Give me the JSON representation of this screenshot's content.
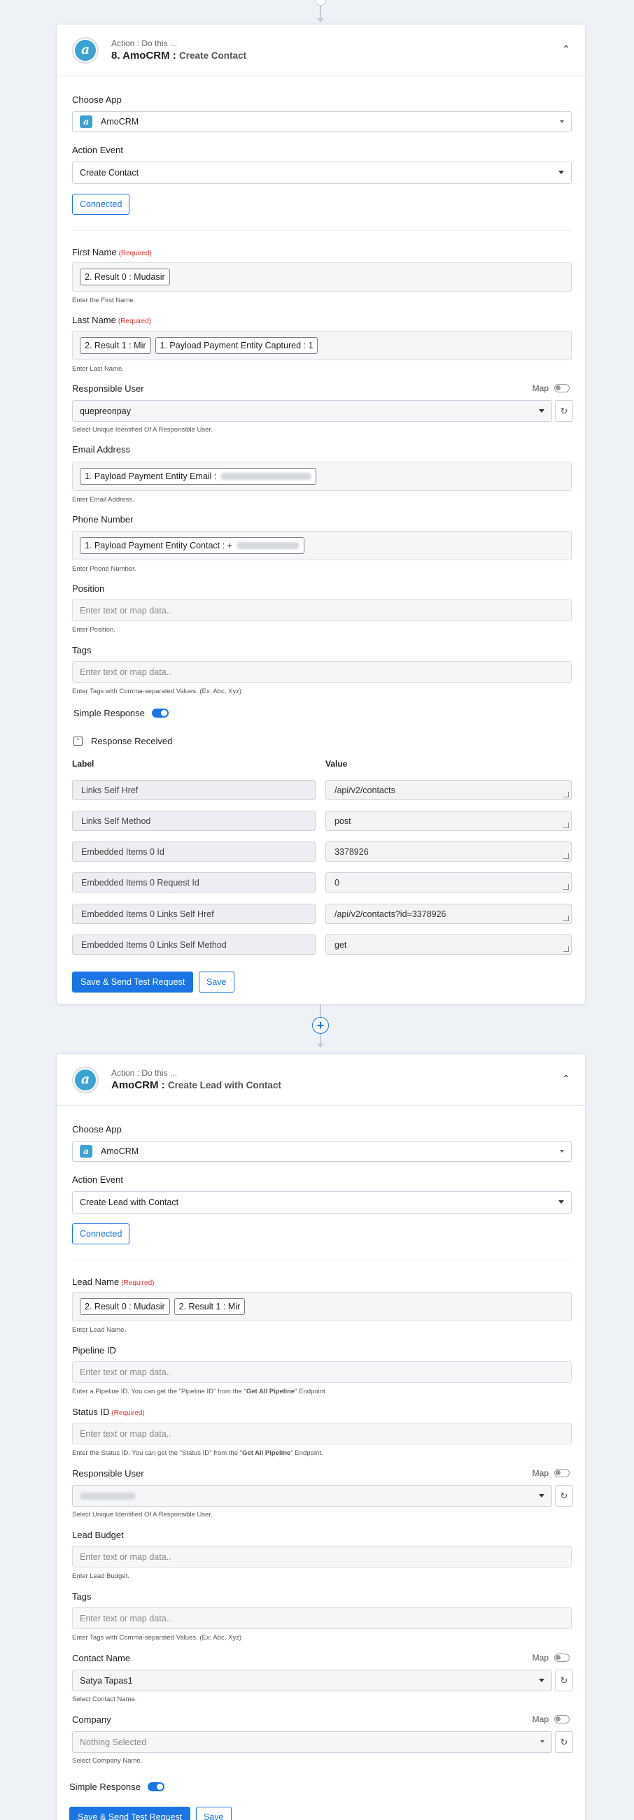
{
  "card1": {
    "head_sub": "Action : Do this ...",
    "head_title": "8. AmoCRM :",
    "head_event": "Create Contact",
    "choose_app_label": "Choose App",
    "app_value": "AmoCRM",
    "action_event_label": "Action Event",
    "action_event_value": "Create Contact",
    "connected_label": "Connected",
    "first_name_label": "First Name",
    "required": "(Required)",
    "first_name_chips": [
      "2. Result 0 : Mudasir"
    ],
    "first_name_hint": "Enter the First Name.",
    "last_name_label": "Last Name",
    "last_name_chips": [
      "2. Result 1 : Mir",
      "1. Payload Payment Entity Captured : 1"
    ],
    "last_name_hint": "Enter Last Name.",
    "responsible_user_label": "Responsible User",
    "map_label": "Map",
    "responsible_user_value": "quepreonpay",
    "responsible_user_hint": "Select Unique Identified Of A Responsible User.",
    "email_label": "Email Address",
    "email_chip": "1. Payload Payment Entity Email :",
    "email_hint": "Enter Email Address.",
    "phone_label": "Phone Number",
    "phone_chip": "1. Payload Payment Entity Contact : +",
    "phone_hint": "Enter Phone Number.",
    "position_label": "Position",
    "placeholder": "Enter text or map data..",
    "position_hint": "Enter Position.",
    "tags_label": "Tags",
    "tags_hint": "Enter Tags with Comma-separated Values. (Ex: Abc, Xyz)",
    "simple_response_label": "Simple Response",
    "response_received_label": "Response Received",
    "col_label": "Label",
    "col_value": "Value",
    "response_rows": [
      {
        "label": "Links Self Href",
        "value": "/api/v2/contacts"
      },
      {
        "label": "Links Self Method",
        "value": "post"
      },
      {
        "label": "Embedded Items 0 Id",
        "value": "3378926"
      },
      {
        "label": "Embedded Items 0 Request Id",
        "value": "0"
      },
      {
        "label": "Embedded Items 0  Links Self Href",
        "value": "/api/v2/contacts?id=3378926"
      },
      {
        "label": "Embedded Items 0  Links Self Method",
        "value": "get"
      }
    ],
    "save_test_label": "Save & Send Test Request",
    "save_label": "Save"
  },
  "card2": {
    "head_sub": "Action : Do this ...",
    "head_title": "AmoCRM :",
    "head_event": "Create Lead with Contact",
    "choose_app_label": "Choose App",
    "app_value": "AmoCRM",
    "action_event_label": "Action Event",
    "action_event_value": "Create Lead with Contact",
    "connected_label": "Connected",
    "lead_name_label": "Lead Name",
    "required": "(Required)",
    "lead_name_chips": [
      "2. Result 0 : Mudasir",
      "2. Result 1 : Mir"
    ],
    "lead_name_hint": "Enter Lead Name.",
    "pipeline_label": "Pipeline ID",
    "placeholder": "Enter text or map data..",
    "pipeline_hint_pre": "Enter a Pipeline ID. You can get the \"Pipeline ID\" from the \"",
    "pipeline_hint_bold": "Get All Pipeline",
    "pipeline_hint_post": "\" Endpoint.",
    "status_label": "Status ID",
    "status_hint_pre": "Enter the Status ID. You can get the \"Status ID\" from the \"",
    "status_hint_bold": "Get All Pipeline",
    "status_hint_post": "\" Endpoint.",
    "responsible_user_label": "Responsible User",
    "map_label": "Map",
    "responsible_user_hint": "Select Unique Identified Of A Responsible User.",
    "lead_budget_label": "Lead Budget",
    "lead_budget_hint": "Enter Lead Budget.",
    "tags_label": "Tags",
    "tags_hint": "Enter Tags with Comma-separated Values. (Ex: Abc, Xyz)",
    "contact_name_label": "Contact Name",
    "contact_name_value": "Satya Tapas1",
    "contact_name_hint": "Select Contact Name.",
    "company_label": "Company",
    "company_value": "Nothing Selected",
    "company_hint": "Select Company Name.",
    "simple_response_label": "Simple Response",
    "save_test_label": "Save & Send Test Request",
    "save_label": "Save"
  },
  "colors": {
    "accent": "#1b74e4",
    "required": "#e03030",
    "app_brand": "#3aa3d1"
  },
  "icons": {
    "app": "amocrm-logo-icon",
    "collapse": "chevron-up-icon",
    "refresh": "refresh-icon",
    "add": "plus-icon"
  }
}
